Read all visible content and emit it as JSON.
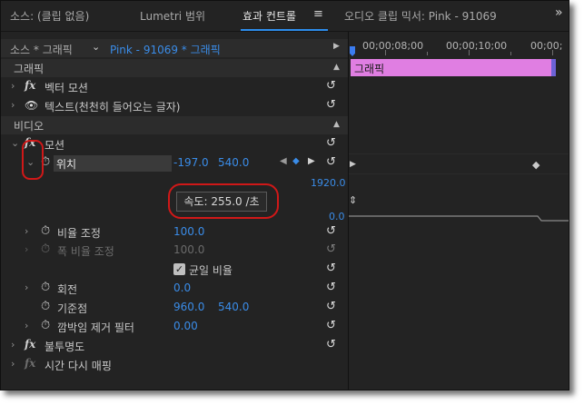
{
  "tabs": [
    {
      "label": "소스: (클립 없음)",
      "active": false
    },
    {
      "label": "Lumetri 범위",
      "active": false
    },
    {
      "label": "효과 컨트롤",
      "active": true
    },
    {
      "label": "오디오 클립 믹서: Pink - 91069",
      "active": false
    }
  ],
  "tab_menu_glyph": "≡",
  "tab_overflow_glyph": "»",
  "source_bar": {
    "source_label": "소스 * 그래픽",
    "clip_label": "Pink - 91069 * 그래픽"
  },
  "sections": {
    "graphics": "그래픽",
    "video": "비디오"
  },
  "effects": {
    "vector_motion": "벡터 모션",
    "text_layer": "텍스트(천천히 들어오는 글자)",
    "motion": "모션",
    "opacity": "불투명도",
    "time_remap": "시간 다시 매핑"
  },
  "properties": {
    "position": {
      "label": "위치",
      "x": "-197.0",
      "y": "540.0"
    },
    "scale": {
      "label": "비율 조정",
      "value": "100.0"
    },
    "scale_width": {
      "label": "폭 비율 조정",
      "value": "100.0"
    },
    "uniform_scale": {
      "label": "균일 비율",
      "checked": true
    },
    "rotation": {
      "label": "회전",
      "value": "0.0"
    },
    "anchor": {
      "label": "기준점",
      "x": "960.0",
      "y": "540.0"
    },
    "anti_flicker": {
      "label": "깜박임 제거 필터",
      "value": "0.00"
    }
  },
  "tooltip": {
    "text": "속도: 255.0 /초"
  },
  "timeline": {
    "timecodes": [
      "00;00;08;00",
      "00;00;10;00",
      "00;00;"
    ],
    "clip_label": "그래픽",
    "graph_max": "1920.0",
    "graph_min": "0.0"
  },
  "colors": {
    "accent_blue": "#3a8ce8",
    "clip_pink": "#e07ee2",
    "highlight_red": "#d01818"
  }
}
